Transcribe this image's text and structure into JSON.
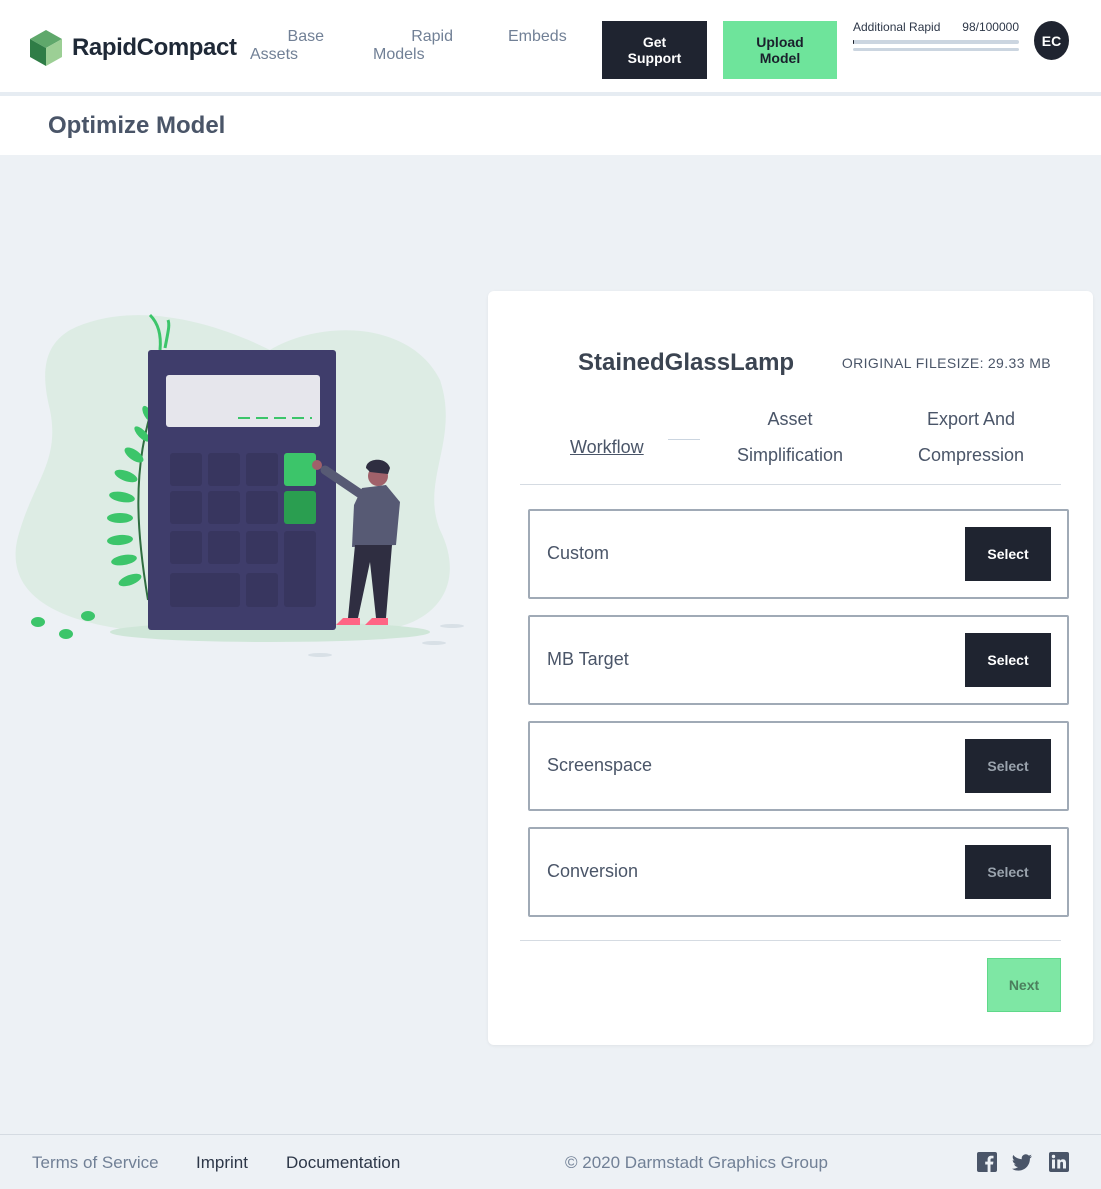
{
  "header": {
    "brand": "RapidCompact",
    "nav": [
      {
        "line1": "Base",
        "line2": "Assets"
      },
      {
        "line1": "Rapid",
        "line2": "Models"
      },
      {
        "line1": "Embeds",
        "line2": ""
      }
    ],
    "support_button": {
      "line1": "Get",
      "line2": "Support"
    },
    "upload_button": {
      "line1": "Upload",
      "line2": "Model"
    },
    "quota": {
      "label": "Additional Rapid",
      "value": "98/100000",
      "used_fraction": 0.00098
    },
    "avatar_initials": "EC"
  },
  "page": {
    "title": "Optimize Model"
  },
  "card": {
    "model_name": "StainedGlassLamp",
    "filesize_label": "ORIGINAL FILESIZE:",
    "filesize_value": "29.33 MB",
    "steps": {
      "workflow": "Workflow",
      "asset_line1": "Asset",
      "asset_line2": "Simplification",
      "export_line1": "Export And",
      "export_line2": "Compression"
    },
    "options": [
      {
        "label": "Custom",
        "button": "Select"
      },
      {
        "label": "MB Target",
        "button": "Select"
      },
      {
        "label": "Screenspace",
        "button": "Select"
      },
      {
        "label": "Conversion",
        "button": "Select"
      }
    ],
    "next_button": "Next"
  },
  "footer": {
    "terms": "Terms of Service",
    "imprint": "Imprint",
    "documentation": "Documentation",
    "copyright": "© 2020 Darmstadt Graphics Group",
    "social": [
      "facebook-icon",
      "twitter-icon",
      "linkedin-icon"
    ]
  },
  "colors": {
    "accent_green": "#6ee49b",
    "dark": "#1f2430",
    "background": "#edf1f5"
  }
}
